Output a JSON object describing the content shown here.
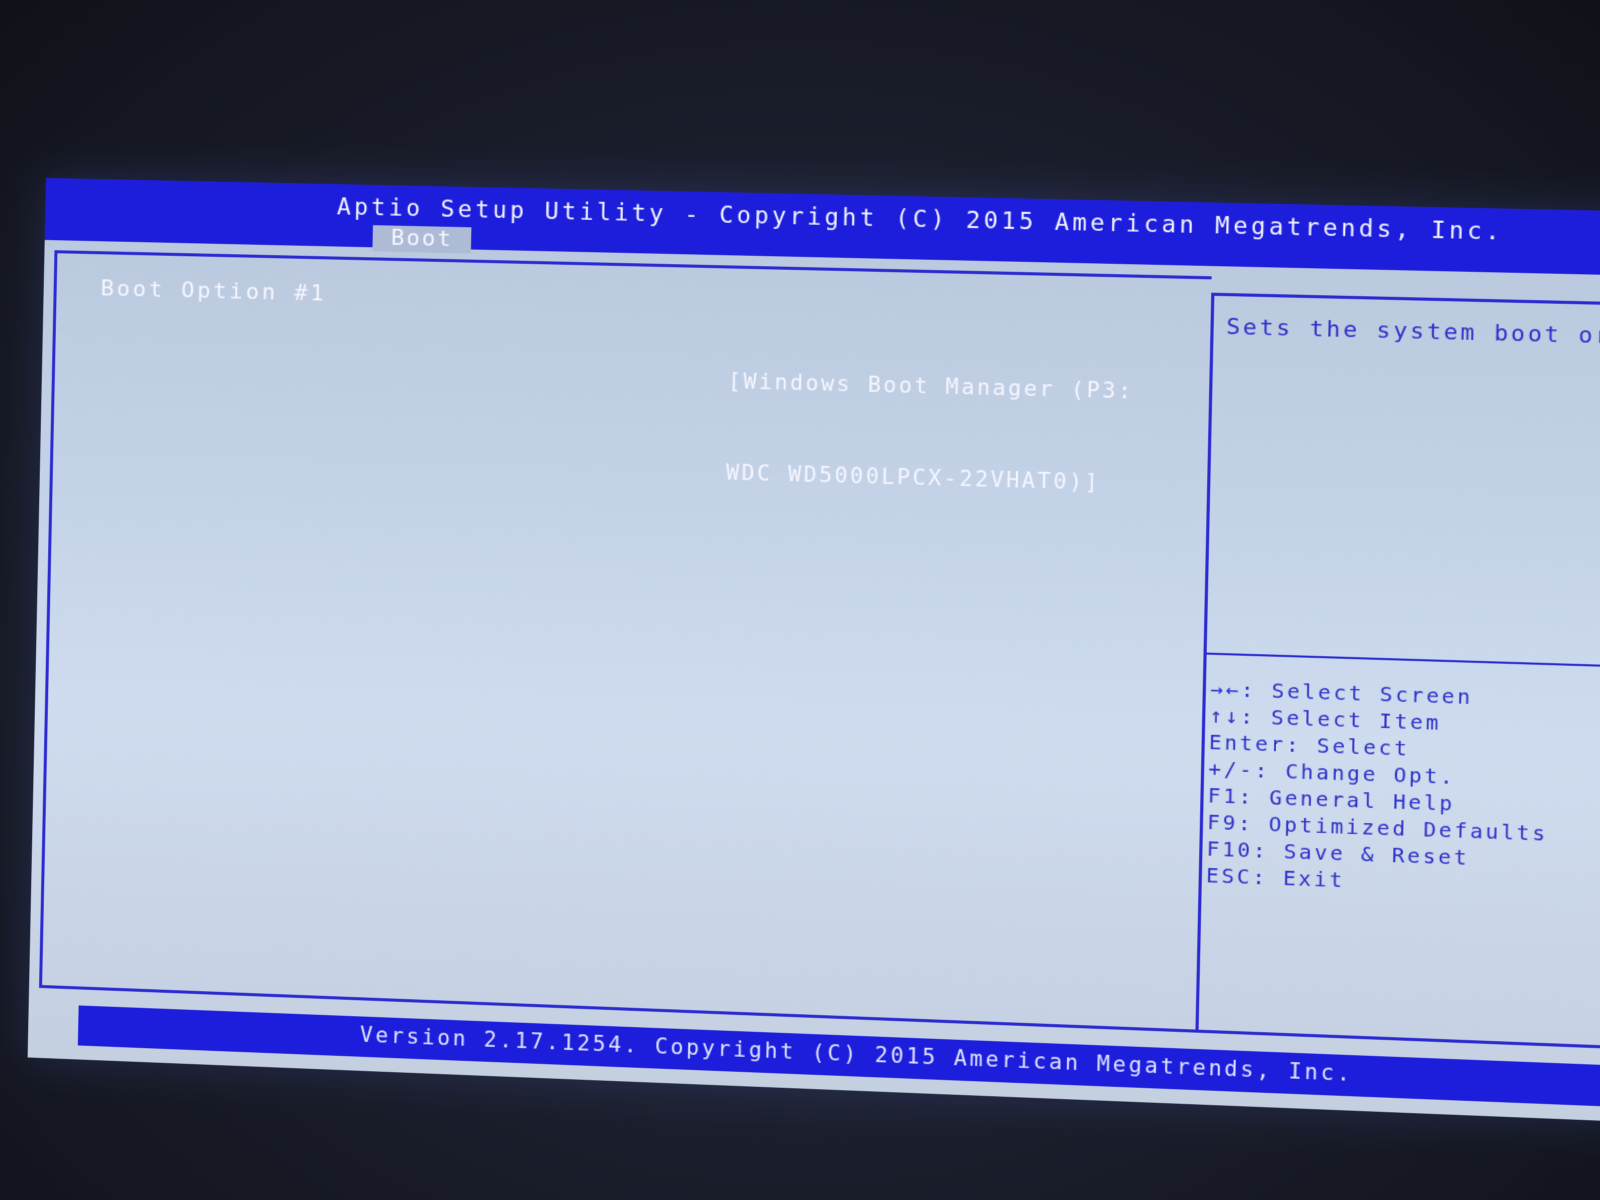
{
  "header": {
    "title": "Aptio Setup Utility - Copyright (C) 2015 American Megatrends, Inc.",
    "active_tab": "Boot"
  },
  "main": {
    "options": [
      {
        "label": "Boot Option #1",
        "value_line1": "[Windows Boot Manager (P3:",
        "value_line2": "WDC WD5000LPCX-22VHAT0)]"
      }
    ]
  },
  "help": {
    "description": "Sets the system boot order",
    "keys": [
      {
        "icon": "left-right-arrows-icon",
        "text": "→←: Select Screen"
      },
      {
        "icon": "up-down-arrows-icon",
        "text": "↑↓: Select Item"
      },
      {
        "icon": "",
        "text": "Enter: Select"
      },
      {
        "icon": "",
        "text": "+/-: Change Opt."
      },
      {
        "icon": "",
        "text": "F1: General Help"
      },
      {
        "icon": "",
        "text": "F9: Optimized Defaults"
      },
      {
        "icon": "",
        "text": "F10: Save & Reset"
      },
      {
        "icon": "",
        "text": "ESC: Exit"
      }
    ]
  },
  "footer": {
    "text": "Version 2.17.1254. Copyright (C) 2015 American Megatrends, Inc."
  },
  "colors": {
    "header_blue": "#1c1edc",
    "panel_bg": "#c6d4ea",
    "help_text": "#2d2fc8",
    "highlight_text": "#f4f6ff"
  }
}
